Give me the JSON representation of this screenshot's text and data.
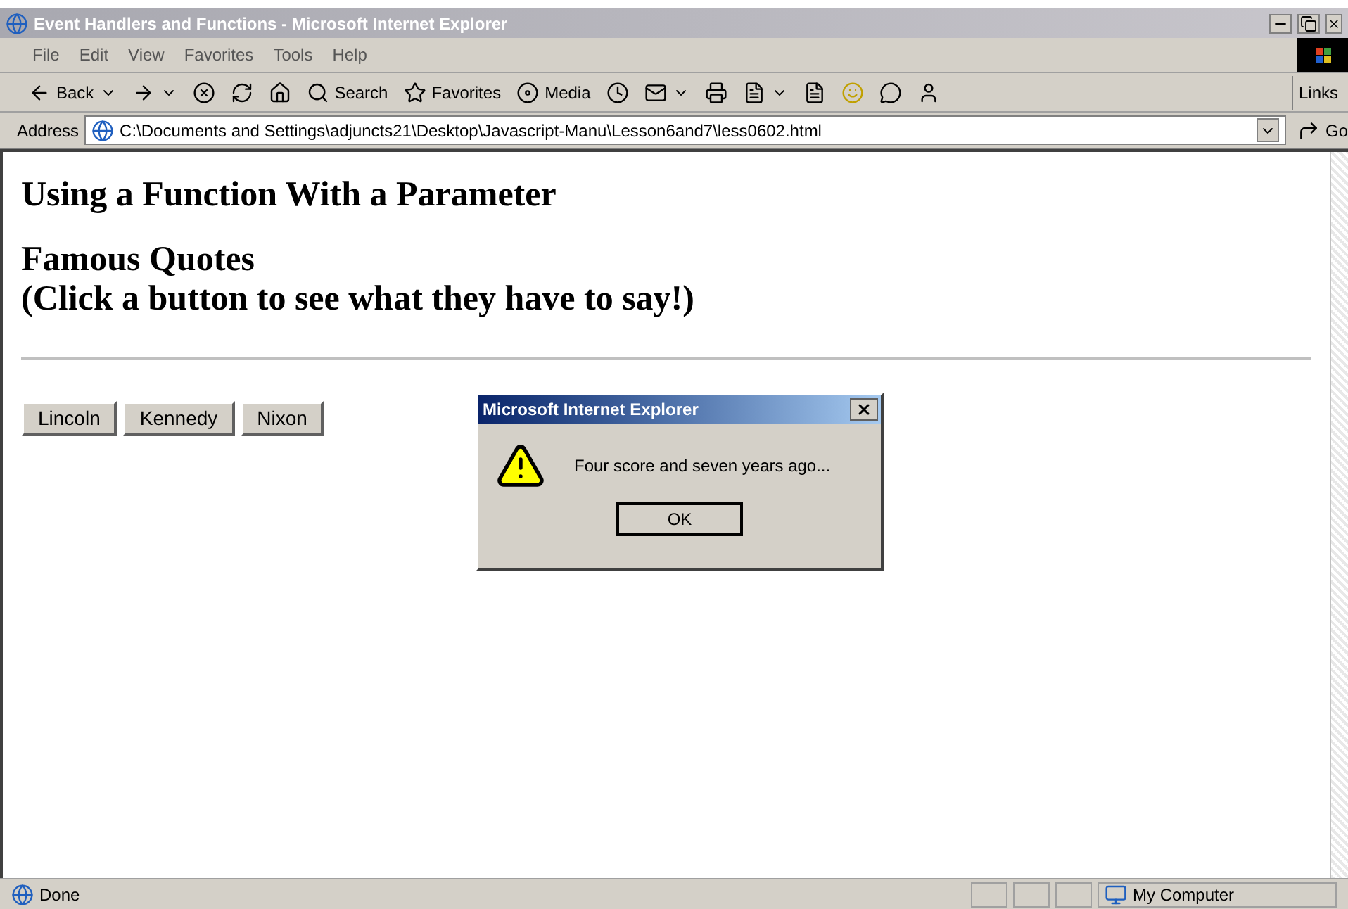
{
  "window": {
    "title": "Event Handlers and Functions - Microsoft Internet Explorer"
  },
  "menu": [
    "File",
    "Edit",
    "View",
    "Favorites",
    "Tools",
    "Help"
  ],
  "toolbar": {
    "back": "Back",
    "search": "Search",
    "favorites": "Favorites",
    "media": "Media",
    "links": "Links"
  },
  "address": {
    "label": "Address",
    "value": "C:\\Documents and Settings\\adjuncts21\\Desktop\\Javascript-Manu\\Lesson6and7\\less0602.html",
    "go": "Go"
  },
  "page": {
    "heading": "Using a Function With a Parameter",
    "subheading": [
      "Famous Quotes",
      "(Click a button to see what they have to say!)"
    ],
    "buttons": [
      "Lincoln",
      "Kennedy",
      "Nixon"
    ]
  },
  "dialog": {
    "title": "Microsoft Internet Explorer",
    "message": "Four score and seven years ago...",
    "ok": "OK"
  },
  "status_bar": {
    "text": "Done",
    "zone": "My Computer"
  }
}
